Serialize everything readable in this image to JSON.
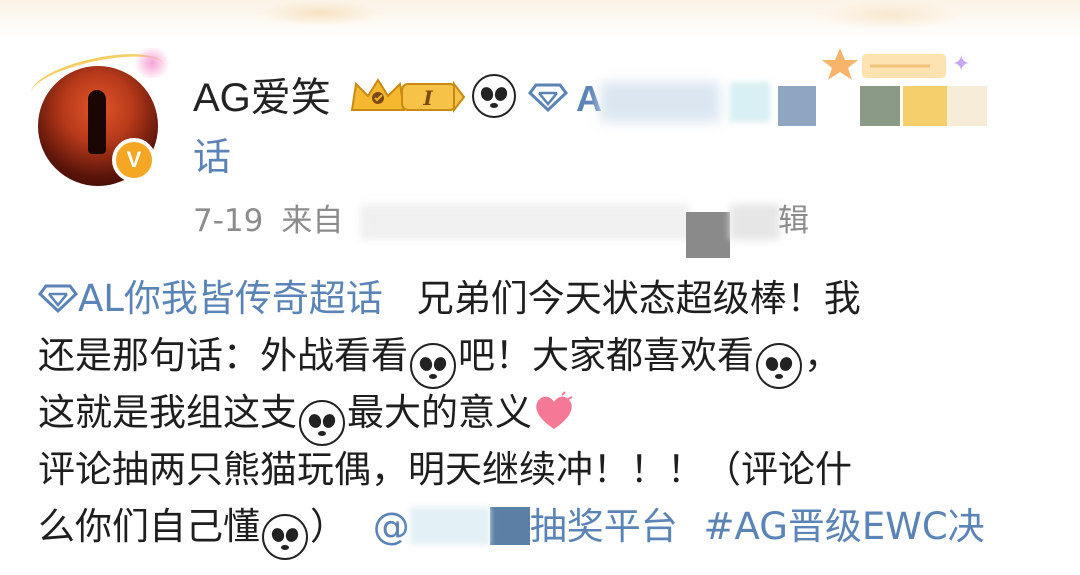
{
  "post": {
    "author": {
      "name": "AG爱笑",
      "vip_level": "I",
      "verified_badge": "V",
      "topic_prefix_partial": "A",
      "topic_tail": "话"
    },
    "meta": {
      "date": "7-19",
      "source_prefix": "来自",
      "source_tail": "辑"
    },
    "content": {
      "supertopic": "AL你我皆传奇超话",
      "line1_text": "兄弟们今天状态超级棒！我",
      "line2_a": "还是那句话：外战看看",
      "line2_b": "吧！大家都喜欢看",
      "line2_c": "，",
      "line3_a": "这就是我组这支",
      "line3_b": "最大的意义",
      "line4": "评论抽两只熊猫玩偶，明天继续冲！！！（评论什",
      "line5_a": "么你们自己懂",
      "line5_b": "）",
      "mention_prefix": "@",
      "mention_tail": "抽奖平台",
      "hashtag": "#AG晋级EWC决"
    },
    "icons": [
      "crown-icon",
      "panda-emoji",
      "diamond-supertopic-icon",
      "heart-emoji",
      "verified-v-icon"
    ],
    "colors": {
      "link": "#5b84b6",
      "text": "#1e1e1e",
      "meta": "#8c8c8c",
      "vip_gold": "#f5b82e",
      "verified": "#f5a623"
    }
  }
}
